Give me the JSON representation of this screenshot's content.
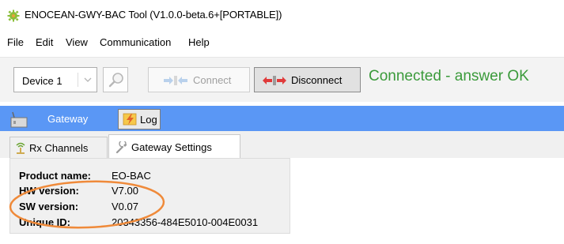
{
  "window": {
    "title": "ENOCEAN-GWY-BAC Tool (V1.0.0-beta.6+[PORTABLE])",
    "icon": "gear-icon"
  },
  "menu": [
    "File",
    "Edit",
    "View",
    "Communication",
    "Help"
  ],
  "toolbar": {
    "device_select": "Device 1",
    "connect_label": "Connect",
    "disconnect_label": "Disconnect",
    "status": "Connected - answer OK"
  },
  "tabs": {
    "gateway_label": "Gateway",
    "log_label": "Log"
  },
  "subtabs": [
    "Rx Channels",
    "Gateway Settings"
  ],
  "gateway_info": [
    {
      "key": "Product name:",
      "value": "EO-BAC"
    },
    {
      "key": "HW version:",
      "value": "V7.00"
    },
    {
      "key": "SW version:",
      "value": "V0.07"
    },
    {
      "key": "Unique ID:",
      "value": "20343356-484E5010-004E0031"
    }
  ],
  "colors": {
    "status_green": "#3a9a3a",
    "gateway_bar": "#5a97f5",
    "annotation": "#ef8a3a"
  }
}
